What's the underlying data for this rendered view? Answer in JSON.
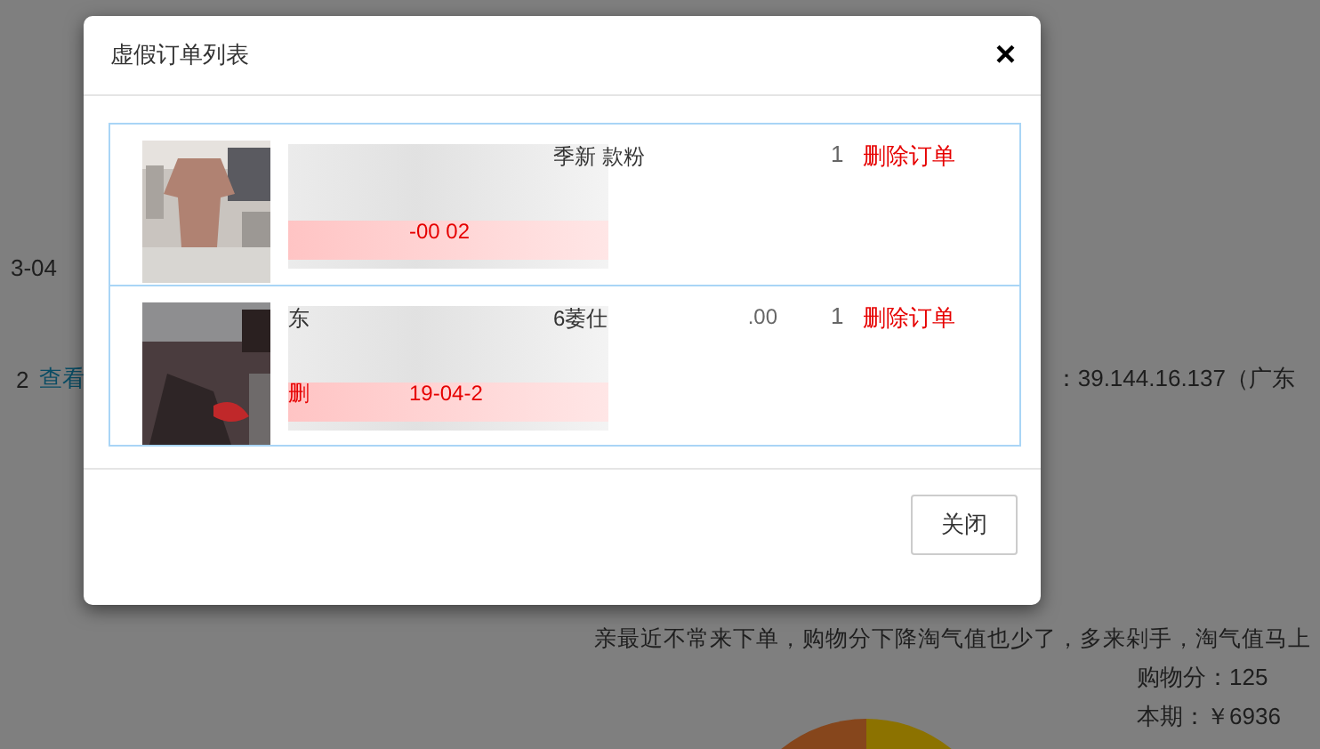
{
  "page": {
    "left_texts": [
      "3-04"
    ],
    "count": "2",
    "view_link": "查看",
    "ip_text": "：39.144.16.137（广东",
    "notice": "亲最近不常来下单，购物分下降淘气值也少了，多来剁手，淘气值马上",
    "stats": [
      "购物分：125",
      "本期：￥6936"
    ]
  },
  "dialog": {
    "title": "虚假订单列表",
    "close_icon": "×",
    "rows": [
      {
        "name_end": "季新 款粉",
        "date": "-00 02",
        "quantity": "1",
        "action": "删除订单"
      },
      {
        "name_start": "东",
        "name_end": "6萎仕",
        "price": ".00",
        "date_start": "删",
        "date": "19-04-2",
        "quantity": "1",
        "action": "删除订单"
      }
    ],
    "close_button": "关闭"
  }
}
